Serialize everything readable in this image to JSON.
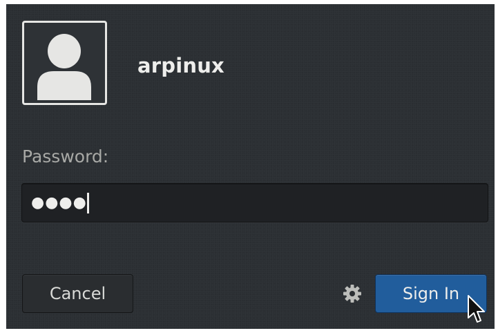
{
  "user": {
    "name": "arpinux",
    "avatar_icon": "user-silhouette-icon"
  },
  "password": {
    "label": "Password:",
    "masked_value": "●●●●"
  },
  "buttons": {
    "cancel_label": "Cancel",
    "signin_label": "Sign In",
    "settings_icon": "gear-icon"
  },
  "colors": {
    "panel_background": "#2b2f33",
    "signin_accent": "#215d9c",
    "text_primary": "#eeeeec",
    "text_secondary": "#a8a9a6"
  }
}
